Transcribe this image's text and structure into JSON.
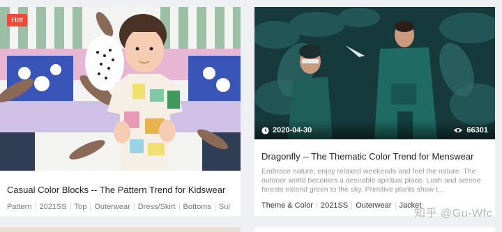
{
  "left_card": {
    "badge": "Hot",
    "title": "Casual Color Blocks -- The Pattern Trend for Kidswear",
    "tags": [
      "Pattern",
      "2021SS",
      "Top",
      "Outerwear",
      "Dress/Skirt",
      "Bottoms",
      "Sui"
    ]
  },
  "right_card": {
    "date": "2020-04-30",
    "views": "66301",
    "title": "Dragonfly -- The Thematic Color Trend for Menswear",
    "description": "Embrace nature, enjoy relaxed weekends and feel the nature. The outdoor world becomes a desirable spiritual place. Lush and serene forests extend green to the sky. Primitive plants show t...",
    "tags": [
      "Theme & Color",
      "2021SS",
      "Outerwear",
      "Jacket"
    ]
  },
  "watermark": "知乎 @Gu-Wfc",
  "icons": {
    "date": "clock-icon",
    "views": "eye-icon"
  },
  "colors": {
    "hot": "#ee4b3a",
    "forest": "#1f4a4a"
  }
}
